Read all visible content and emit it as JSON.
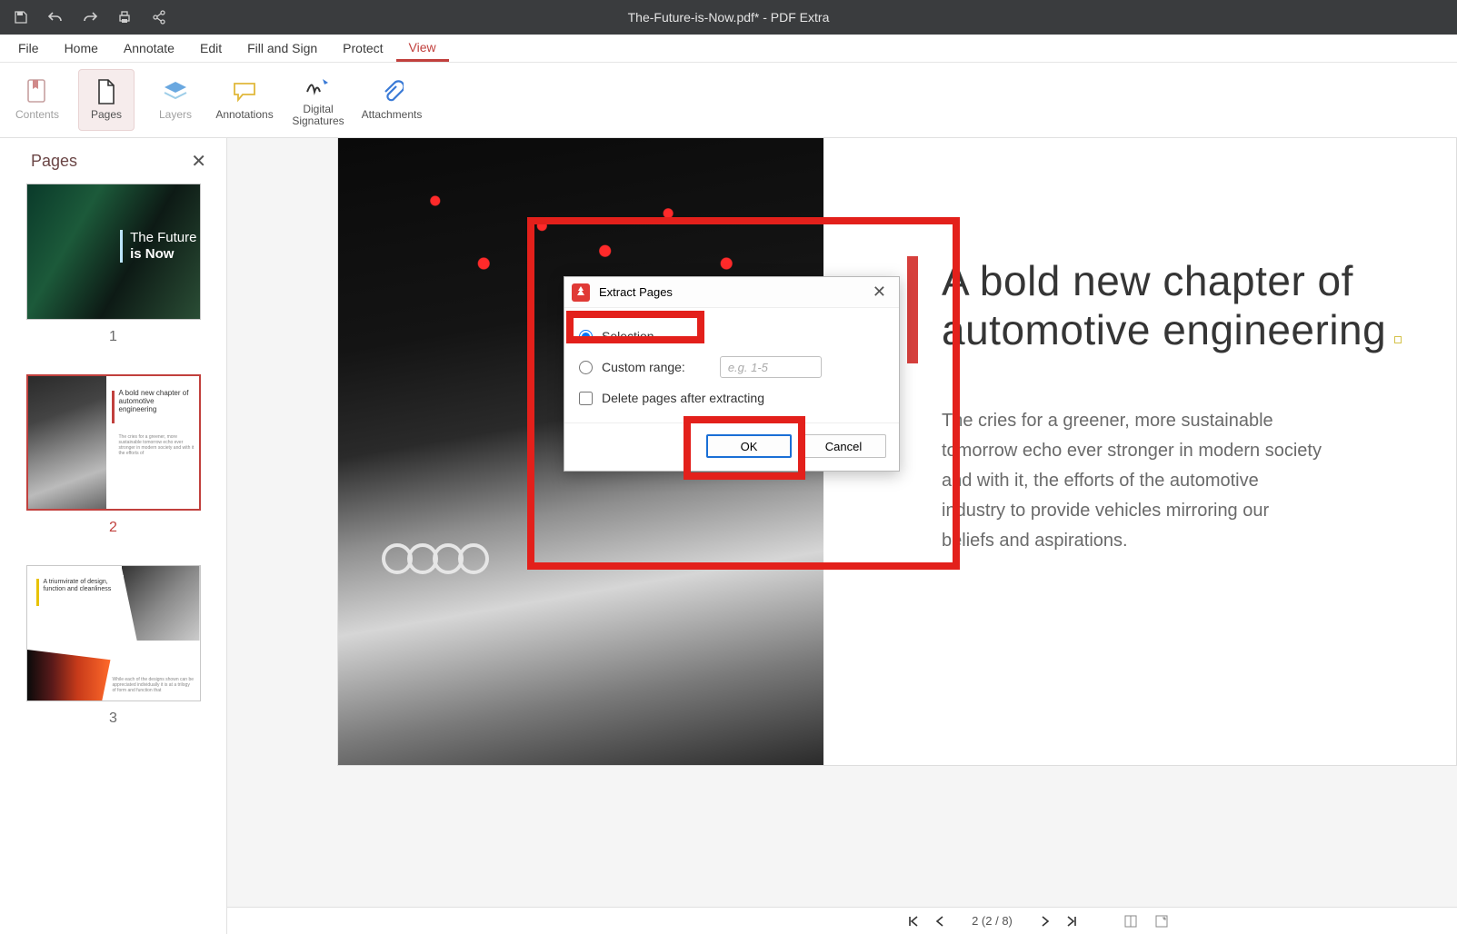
{
  "titlebar": {
    "title": "The-Future-is-Now.pdf* - PDF Extra"
  },
  "menu": {
    "items": [
      "File",
      "Home",
      "Annotate",
      "Edit",
      "Fill and Sign",
      "Protect",
      "View"
    ],
    "active_index": 6
  },
  "ribbon": {
    "buttons": [
      {
        "label": "Contents",
        "disabled": true
      },
      {
        "label": "Pages",
        "active": true
      },
      {
        "label": "Layers",
        "disabled": true
      },
      {
        "label": "Annotations"
      },
      {
        "label": "Digital\nSignatures"
      },
      {
        "label": "Attachments"
      }
    ]
  },
  "sidebar": {
    "title": "Pages",
    "thumbs": [
      {
        "num": "1",
        "title_line1": "The Future",
        "title_line2": "is Now"
      },
      {
        "num": "2",
        "heading": "A bold new chapter of automotive engineering"
      },
      {
        "num": "3",
        "heading": "A triumvirate of design, function and cleanliness"
      }
    ],
    "selected_index": 1
  },
  "page": {
    "heading": "A bold new chapter of automotive engineering",
    "body": "The cries for a greener, more sustainable tomorrow echo ever stronger in modern society and with it, the efforts of the automotive industry to provide vehicles mirroring our beliefs and aspirations."
  },
  "dialog": {
    "title": "Extract Pages",
    "option_selection": "Selection",
    "option_range_label": "Custom range:",
    "range_placeholder": "e.g. 1-5",
    "delete_label": "Delete pages after extracting",
    "ok": "OK",
    "cancel": "Cancel"
  },
  "nav": {
    "page_status": "2 (2 / 8)"
  }
}
